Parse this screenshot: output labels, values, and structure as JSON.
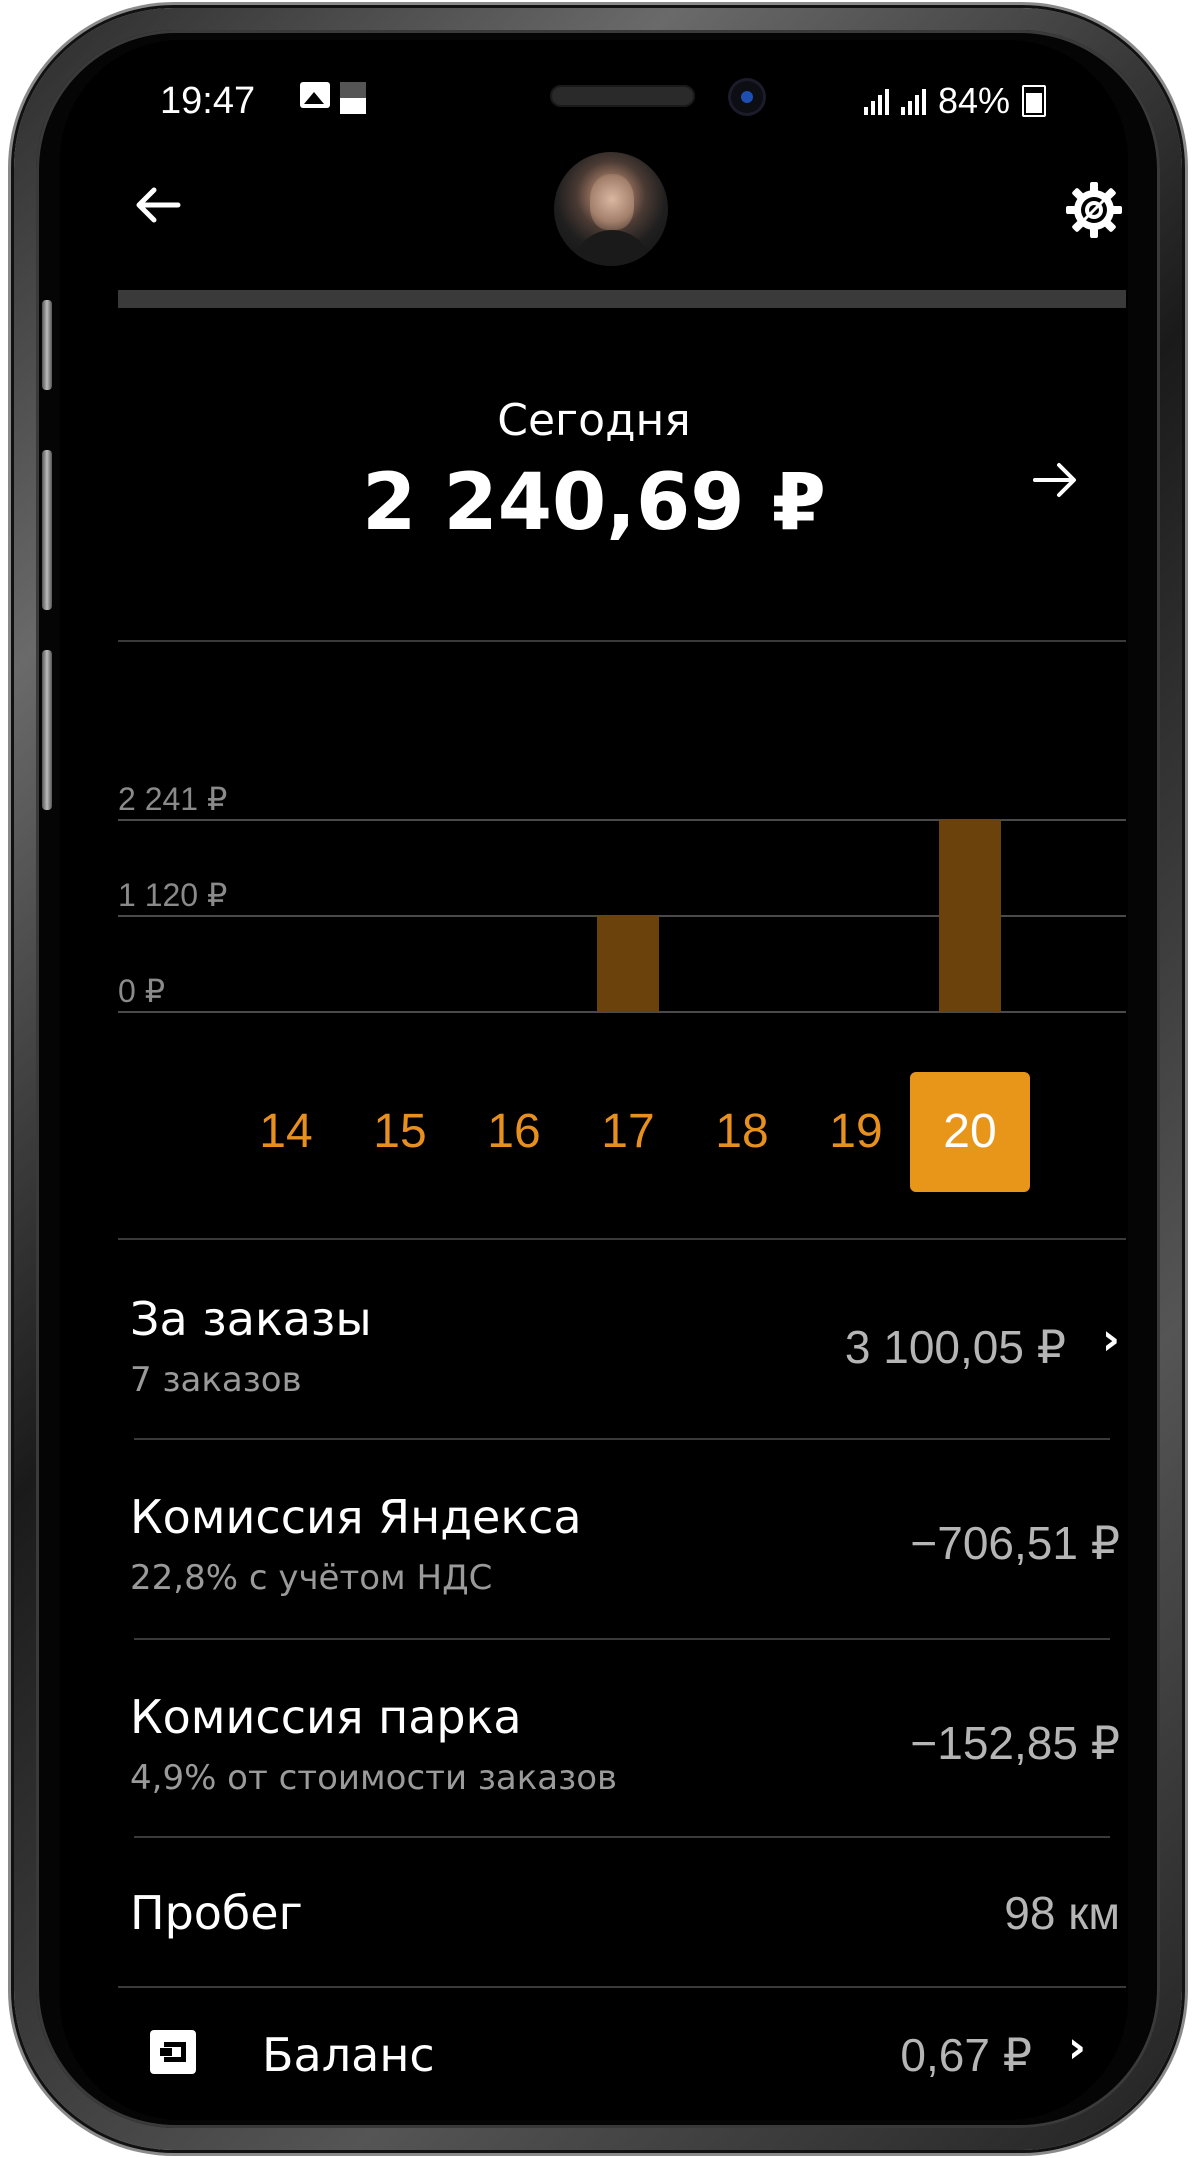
{
  "status_bar": {
    "time": "19:47",
    "signal": ".ıl .ıl",
    "battery": "84%"
  },
  "header": {
    "back_icon": "arrow-left-icon",
    "settings_icon": "gear-icon",
    "avatar": "driver-avatar"
  },
  "summary": {
    "period_label": "Сегодня",
    "amount": "2 240,69 ₽",
    "next_icon": "arrow-right-icon"
  },
  "chart_data": {
    "type": "bar",
    "categories": [
      "14",
      "15",
      "16",
      "17",
      "18",
      "19",
      "20"
    ],
    "values": [
      0,
      0,
      0,
      1120,
      0,
      0,
      2241
    ],
    "ylim": [
      0,
      2241
    ],
    "yticks": [
      {
        "value": 0,
        "label": "0 ₽"
      },
      {
        "value": 1120,
        "label": "1 120 ₽"
      },
      {
        "value": 2241,
        "label": "2 241 ₽"
      }
    ],
    "selected": "20",
    "bar_color": "#6b420c",
    "accent_color": "#e8961a",
    "grid": true
  },
  "rows": [
    {
      "title": "За заказы",
      "subtitle": "7 заказов",
      "value": "3 100,05 ₽",
      "chevron": "›"
    },
    {
      "title": "Комиссия Яндекса",
      "subtitle": "22,8% с учётом НДС",
      "value": "−706,51 ₽"
    },
    {
      "title": "Комиссия парка",
      "subtitle": "4,9% от стоимости заказов",
      "value": "−152,85 ₽"
    },
    {
      "title": "Пробег",
      "value": "98 км"
    }
  ],
  "balance": {
    "icon": "wallet-icon",
    "label": "Баланс",
    "value": "0,67 ₽",
    "chevron": "›"
  }
}
